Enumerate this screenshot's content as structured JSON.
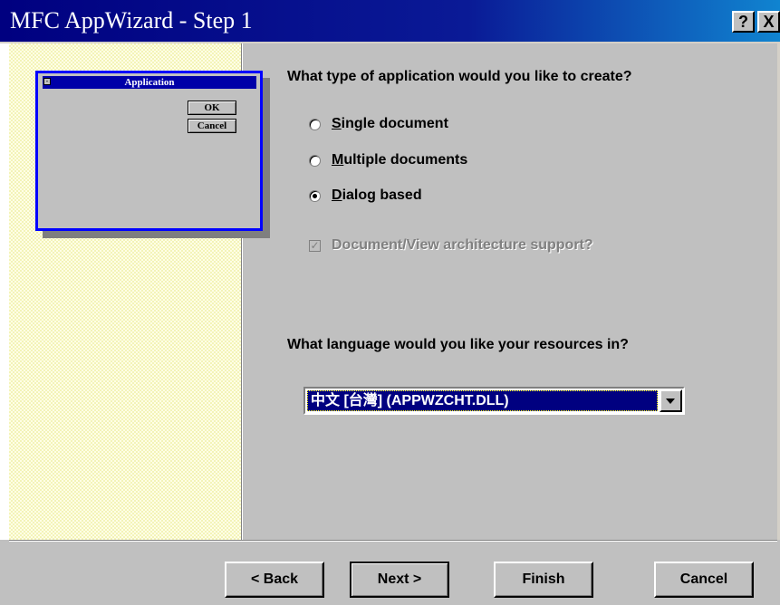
{
  "window": {
    "title": "MFC AppWizard - Step 1",
    "help_button": "?",
    "close_button": "X"
  },
  "preview": {
    "title": "Application",
    "ok_label": "OK",
    "cancel_label": "Cancel"
  },
  "app_type": {
    "question": "What type of application would you like to create?",
    "options": [
      {
        "label": "Single document",
        "mnemonic": "S",
        "rest": "ingle document",
        "selected": false
      },
      {
        "label": "Multiple documents",
        "mnemonic": "M",
        "rest": "ultiple documents",
        "selected": false
      },
      {
        "label": "Dialog based",
        "mnemonic": "D",
        "rest": "ialog based",
        "selected": true
      }
    ],
    "docview": {
      "label": "Document/View architecture support?",
      "checked": true,
      "enabled": false
    }
  },
  "language": {
    "question": "What language would you like your resources in?",
    "selected": "中文 [台灣] (APPWZCHT.DLL)"
  },
  "buttons": {
    "back": "< Back",
    "next": "Next >",
    "finish": "Finish",
    "cancel": "Cancel"
  },
  "colors": {
    "title_bar": "#000080",
    "dialog_bg": "#c0c0c0",
    "selection": "#000080",
    "preview_frame": "#0000ff"
  },
  "icons": {
    "help": "question-mark-icon",
    "close": "close-icon",
    "dropdown": "chevron-down-icon"
  }
}
